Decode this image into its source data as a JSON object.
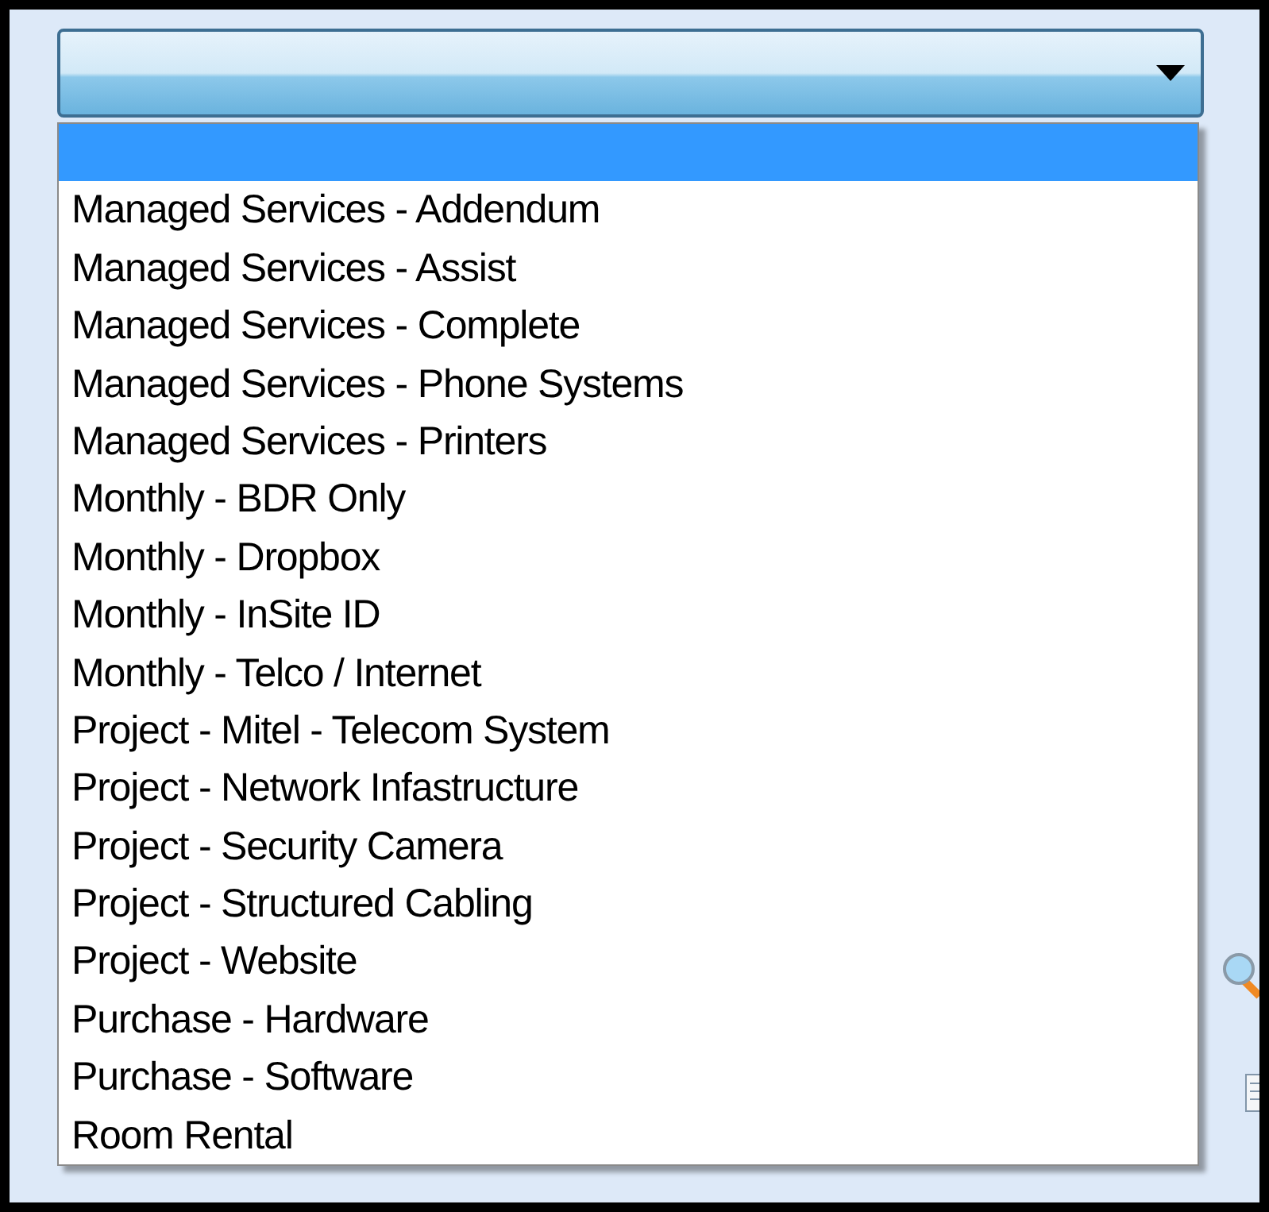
{
  "combo_box": {
    "expanded": true
  },
  "dropdown_list": {
    "items": [
      {
        "selected": true
      },
      {
        "label": "Managed Services - Addendum",
        "selected": false
      },
      {
        "label": "Managed Services - Assist",
        "selected": false
      },
      {
        "label": "Managed Services - Complete",
        "selected": false
      },
      {
        "label": "Managed Services - Phone Systems",
        "selected": false
      },
      {
        "label": "Managed Services - Printers",
        "selected": false
      },
      {
        "label": "Monthly - BDR Only",
        "selected": false
      },
      {
        "label": "Monthly - Dropbox",
        "selected": false
      },
      {
        "label": "Monthly - InSite ID",
        "selected": false
      },
      {
        "label": "Monthly - Telco / Internet",
        "selected": false
      },
      {
        "label": "Project - Mitel - Telecom System",
        "selected": false
      },
      {
        "label": "Project - Network Infastructure",
        "selected": false
      },
      {
        "label": "Project - Security Camera",
        "selected": false
      },
      {
        "label": "Project - Structured Cabling",
        "selected": false
      },
      {
        "label": "Project - Website",
        "selected": false
      },
      {
        "label": "Purchase - Hardware",
        "selected": false
      },
      {
        "label": "Purchase - Software",
        "selected": false
      },
      {
        "label": "Room Rental",
        "selected": false
      }
    ]
  }
}
